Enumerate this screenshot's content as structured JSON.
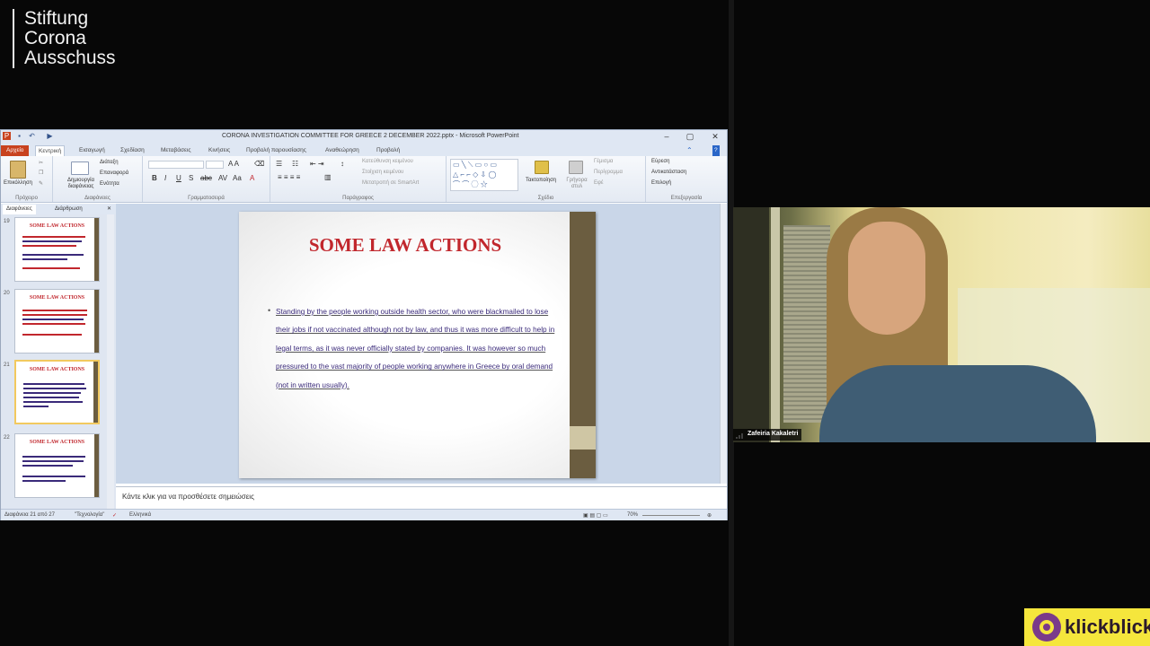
{
  "branding": {
    "logo_lines": [
      "Stiftung",
      "Corona",
      "Ausschuss"
    ]
  },
  "powerpoint": {
    "window_title": "CORONA INVESTIGATION COMMITTEE FOR GREECE 2 DECEMBER 2022.pptx - Microsoft PowerPoint",
    "tabs": [
      "Αρχείο",
      "Κεντρική",
      "Εισαγωγή",
      "Σχεδίαση",
      "Μεταβάσεις",
      "Κινήσεις",
      "Προβολή παρουσίασης",
      "Αναθεώρηση",
      "Προβολή"
    ],
    "ribbon": {
      "paste": "Επικόλληση",
      "new_slide": "Δημιουργία διαφάνειας",
      "layout": "Διάταξη",
      "reset": "Επαναφορά",
      "section": "Ενότητα",
      "text_direction": "Κατεύθυνση κειμένου",
      "align_text": "Στοίχιση κειμένου",
      "convert_smartart": "Μετατροπή σε SmartArt",
      "arrange": "Τακτοποίηση",
      "quick_styles": "Γρήγορα στυλ",
      "shape_fill": "Γέμισμα",
      "shape_outline": "Περίγραμμα",
      "shape_effects": "Εφέ",
      "find": "Εύρεση",
      "replace": "Αντικατάσταση",
      "select": "Επιλογή",
      "groups": [
        "Πρόχειρο",
        "Διαφάνειες",
        "Γραμματοσειρά",
        "Παράγραφος",
        "Σχέδιο",
        "Επεξεργασία"
      ]
    },
    "pane_tabs": [
      "Διαφάνειες",
      "Διάρθρωση"
    ],
    "thumbnails": [
      {
        "number": "19",
        "title": "SOME LAW ACTIONS",
        "selected": false
      },
      {
        "number": "20",
        "title": "SOME LAW ACTIONS",
        "selected": false
      },
      {
        "number": "21",
        "title": "SOME LAW ACTIONS",
        "selected": true
      },
      {
        "number": "22",
        "title": "SOME LAW ACTIONS",
        "selected": false
      }
    ],
    "slide": {
      "title": "SOME LAW ACTIONS",
      "body": "Standing by the people working outside health sector, who were blackmailed to lose their jobs if not vaccinated although not by law,  and thus it was more difficult to help in legal terms, as it was never officially stated by companies.  It was  however so much pressured to the vast majority of people working anywhere in Greece by oral demand (not in written usually)."
    },
    "notes_placeholder": "Κάντε κλικ για να προσθέσετε σημειώσεις",
    "status": {
      "slide_counter": "Διαφάνεια 21 από 27",
      "theme": "\"Τεχνολογία\"",
      "language": "Ελληνικά",
      "zoom": "70%"
    }
  },
  "participant": {
    "name": "Zafeiria Kakaletri"
  },
  "watermark": {
    "text": "klickblick"
  },
  "colors": {
    "slide_title": "#c1272d",
    "slide_text": "#3a2a7a",
    "slide_bar": "#6b5d40",
    "file_tab": "#c8421e",
    "watermark_bg": "#f5e63c"
  }
}
